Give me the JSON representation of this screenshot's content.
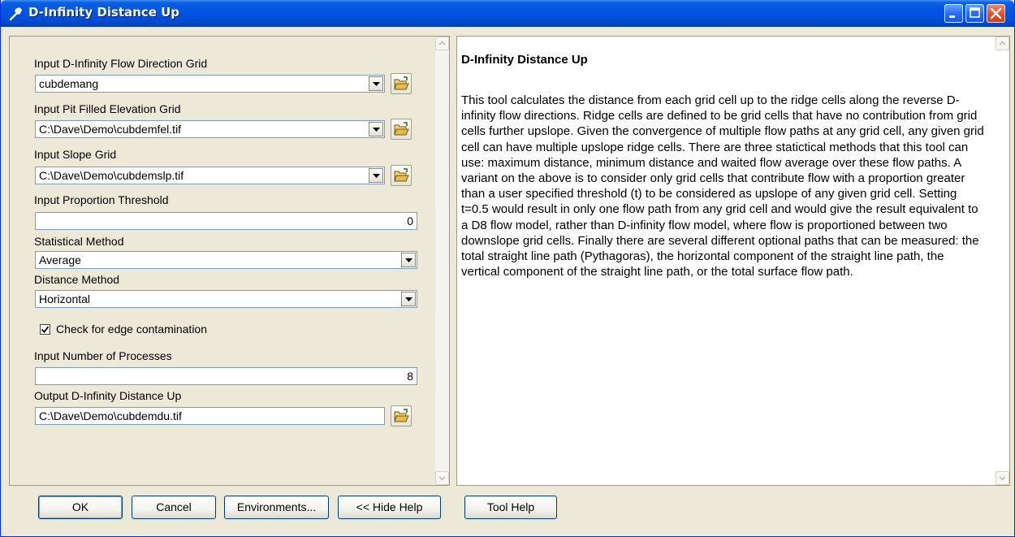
{
  "window": {
    "title": "D-Infinity Distance Up",
    "icon": "hammer-icon"
  },
  "form": {
    "flow_dir_label": "Input D-Infinity Flow Direction Grid",
    "flow_dir_value": "cubdemang",
    "pit_filled_label": "Input Pit Filled Elevation Grid",
    "pit_filled_value": "C:\\Dave\\Demo\\cubdemfel.tif",
    "slope_label": "Input Slope Grid",
    "slope_value": "C:\\Dave\\Demo\\cubdemslp.tif",
    "threshold_label": "Input Proportion Threshold",
    "threshold_value": "0",
    "stat_method_label": "Statistical Method",
    "stat_method_value": "Average",
    "distance_method_label": "Distance Method",
    "distance_method_value": "Horizontal",
    "edge_check_label": "Check for edge contamination",
    "edge_check_checked": true,
    "processes_label": "Input Number of Processes",
    "processes_value": "8",
    "output_label": "Output D-Infinity Distance Up",
    "output_value": "C:\\Dave\\Demo\\cubdemdu.tif"
  },
  "help": {
    "title": "D-Infinity Distance Up",
    "body": "This tool calculates the distance from each grid cell up to the ridge cells along the reverse D-infinity flow directions. Ridge cells are defined to be grid cells that have no contribution from grid cells further upslope. Given the convergence of multiple flow paths at any grid cell, any given grid cell can have multiple upslope ridge cells. There are three statictical methods that this tool can use: maximum distance, minimum distance and waited flow average over these flow paths. A variant on the above is to consider only grid cells that contribute flow with a proportion greater than a user specified threshold (t) to be considered as upslope of any given grid cell. Setting t=0.5 would result in only one flow path from any grid cell and would give the result equivalent to a D8 flow model, rather than D-infinity flow model, where flow is proportioned between two downslope grid cells. Finally there are several different optional paths that can be measured: the total straight line path (Pythagoras), the horizontal component of the straight line path, the vertical component of the straight line path, or the total surface flow path."
  },
  "buttons": {
    "ok": "OK",
    "cancel": "Cancel",
    "environments": "Environments...",
    "hide_help": "<< Hide Help",
    "tool_help": "Tool Help"
  },
  "colors": {
    "titlebar": "#0054e3",
    "dialog_bg": "#ece9d8",
    "input_border": "#7f9db9"
  }
}
